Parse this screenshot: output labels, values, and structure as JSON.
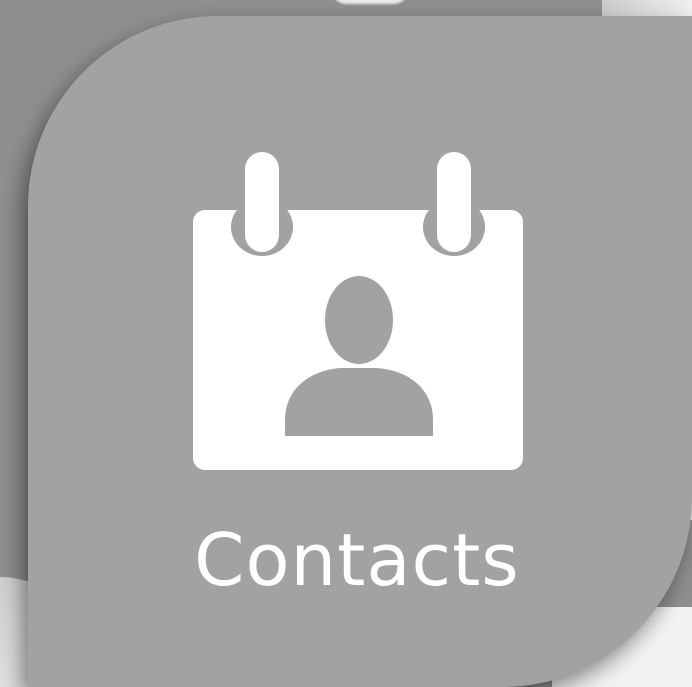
{
  "tile": {
    "label": "Contacts",
    "icon": "contact-card-calendar-icon",
    "colors": {
      "tile_background": "#a2a2a2",
      "icon_foreground": "#ffffff",
      "label_color": "#ffffff"
    }
  }
}
